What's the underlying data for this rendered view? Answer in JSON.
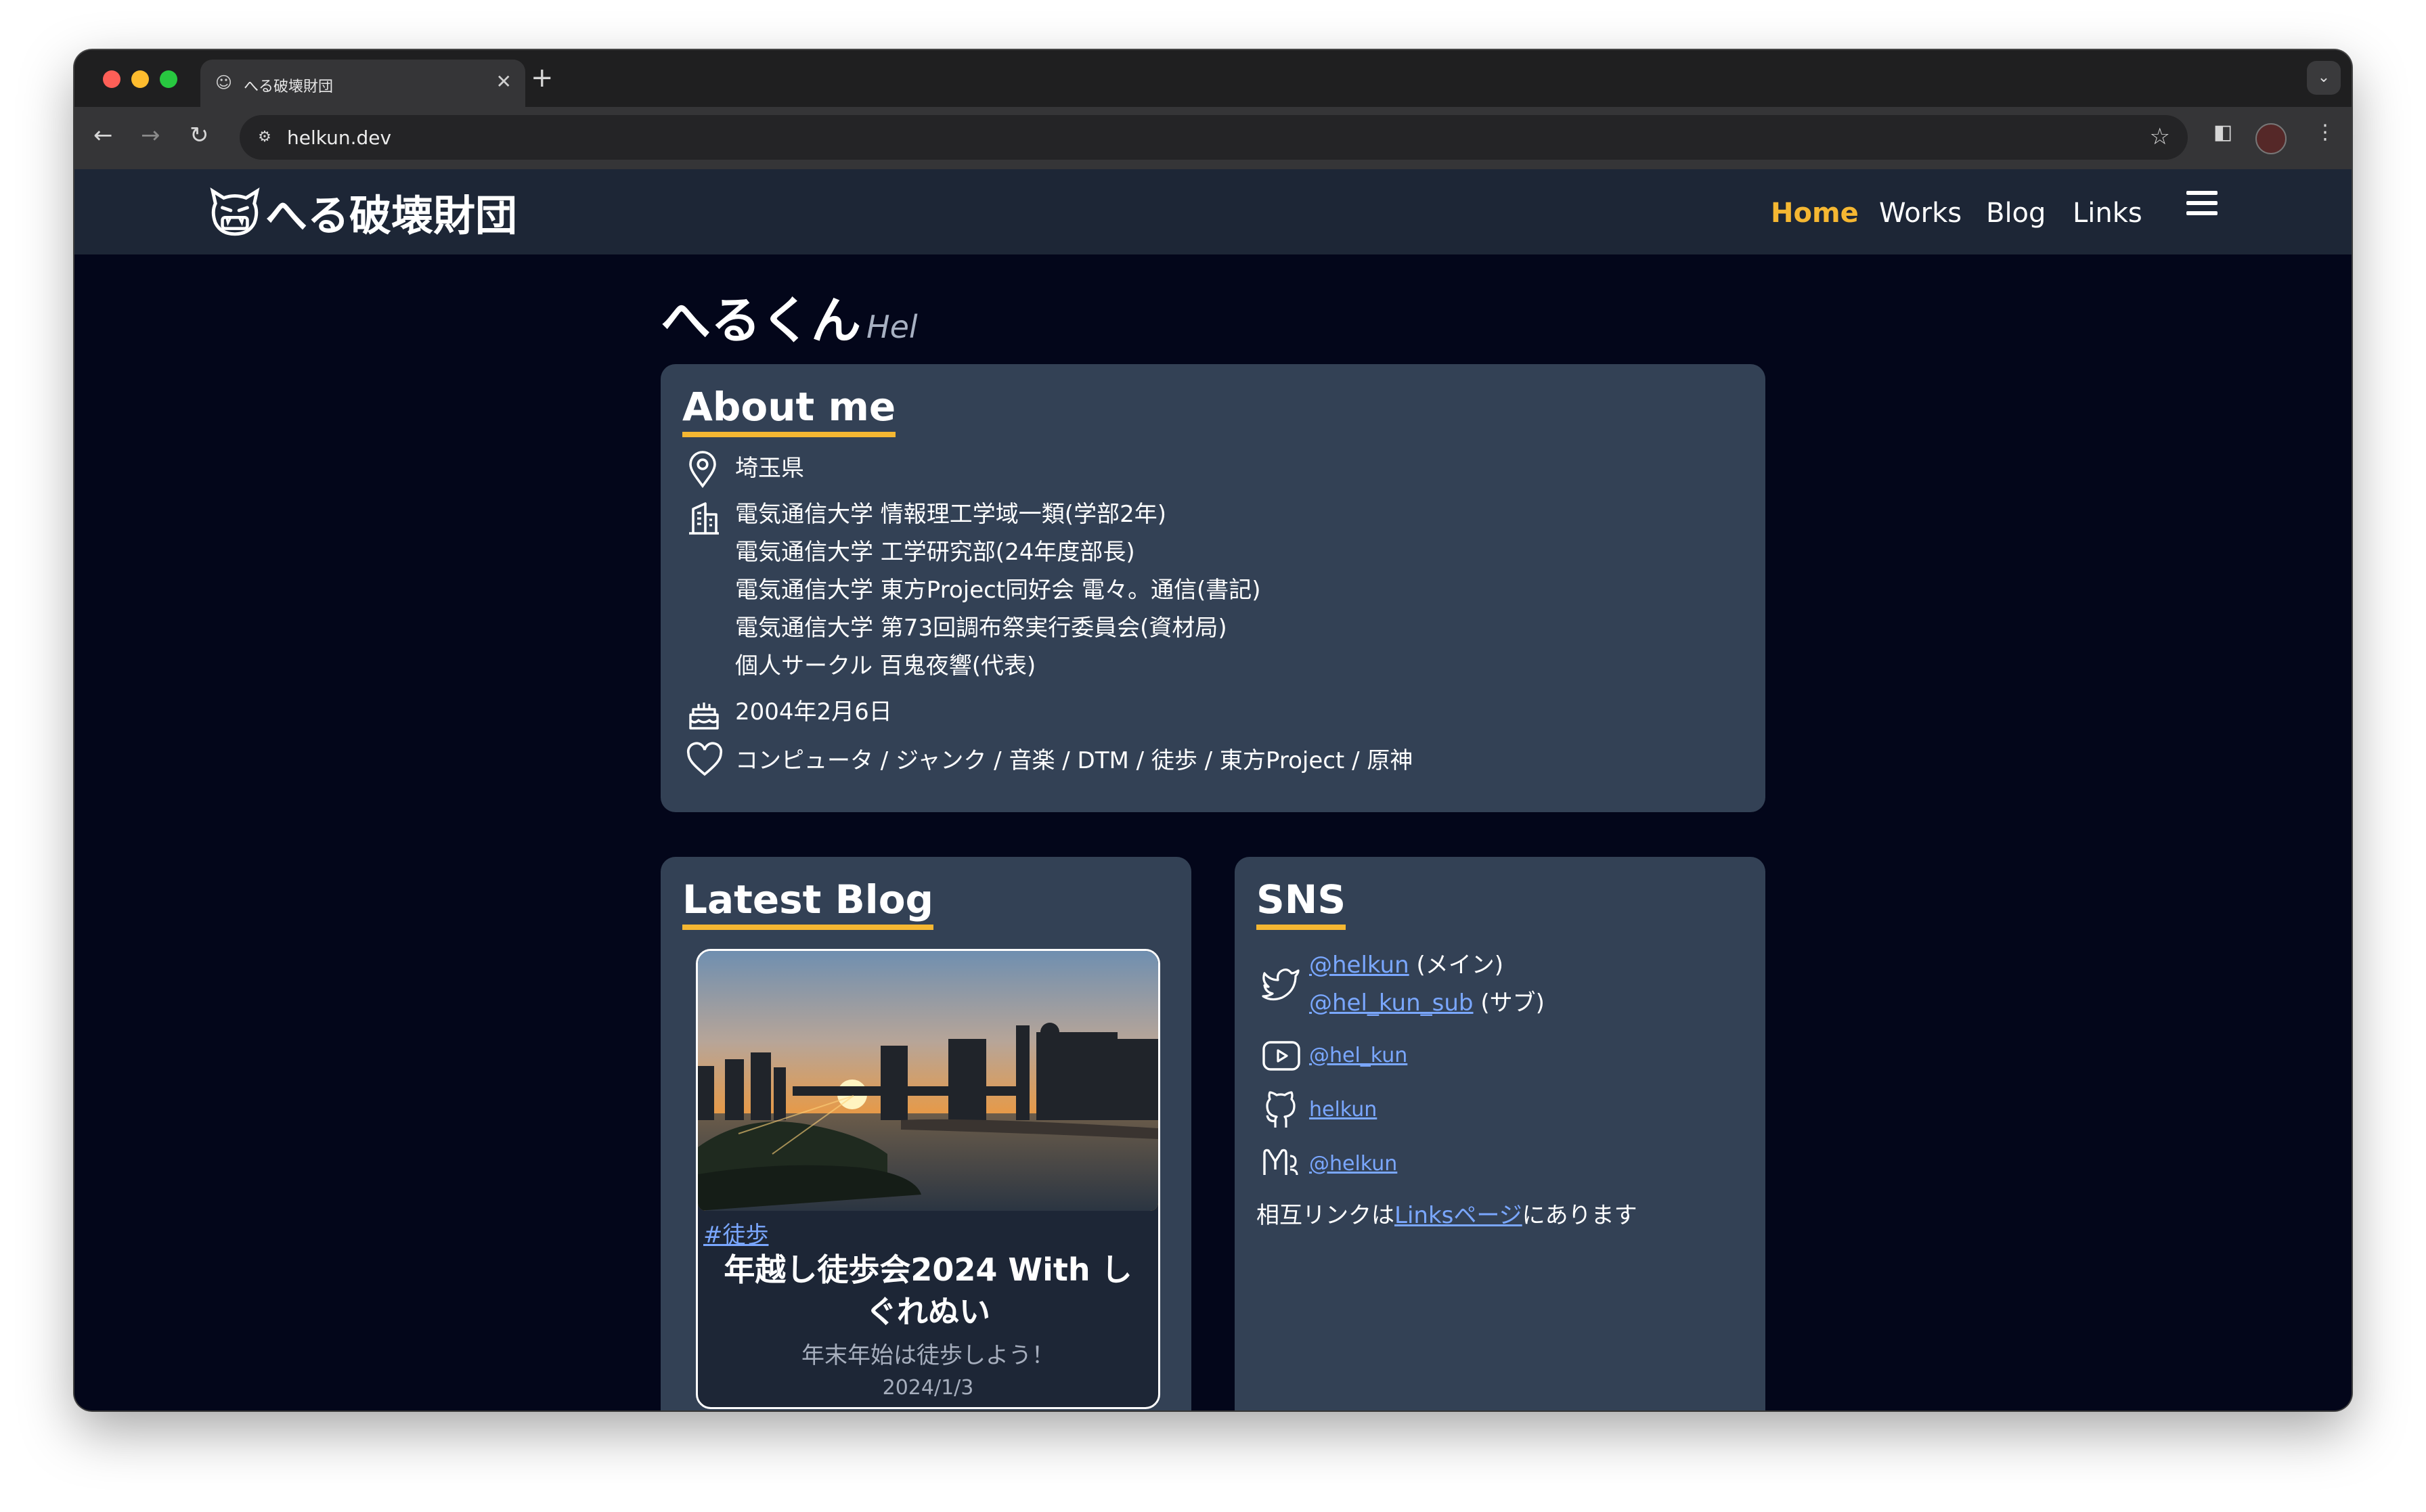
{
  "browser": {
    "tab_title": "へる破壊財団",
    "new_tab": "+",
    "close_tab": "✕",
    "url": "helkun.dev"
  },
  "site": {
    "logo_text": "へる破壊財団",
    "nav": [
      {
        "label": "Home",
        "active": true
      },
      {
        "label": "Works",
        "active": false
      },
      {
        "label": "Blog",
        "active": false
      },
      {
        "label": "Links",
        "active": false
      }
    ]
  },
  "profile": {
    "name": "へるくん",
    "alias": "Hel"
  },
  "about": {
    "title": "About me",
    "location": "埼玉県",
    "affiliations": [
      "電気通信大学 情報理工学域一類(学部2年)",
      "電気通信大学 工学研究部(24年度部長)",
      "電気通信大学 東方Project同好会 電々。通信(書記)",
      "電気通信大学 第73回調布祭実行委員会(資材局)",
      "個人サークル 百鬼夜響(代表)"
    ],
    "birthday": "2004年2月6日",
    "likes": "コンピュータ / ジャンク / 音楽 / DTM / 徒歩 / 東方Project / 原神"
  },
  "latest_blog": {
    "title": "Latest Blog",
    "post": {
      "tag": "#徒歩",
      "title": "年越し徒歩会2024 With しぐれぬい",
      "description": "年末年始は徒歩しよう！",
      "date": "2024/1/3"
    }
  },
  "sns": {
    "title": "SNS",
    "twitter": [
      {
        "handle": "@helkun",
        "note": "(メイン)"
      },
      {
        "handle": "@hel_kun_sub",
        "note": "(サブ)"
      }
    ],
    "youtube": "@hel_kun",
    "github": "helkun",
    "misskey": "@helkun",
    "links_prefix": "相互リンクは",
    "links_link": "Linksページ",
    "links_suffix": "にあります"
  },
  "colors": {
    "accent": "#f5b732",
    "card": "#334155",
    "header": "#1d2636",
    "background": "#03061a",
    "link": "#7aa7ff"
  }
}
